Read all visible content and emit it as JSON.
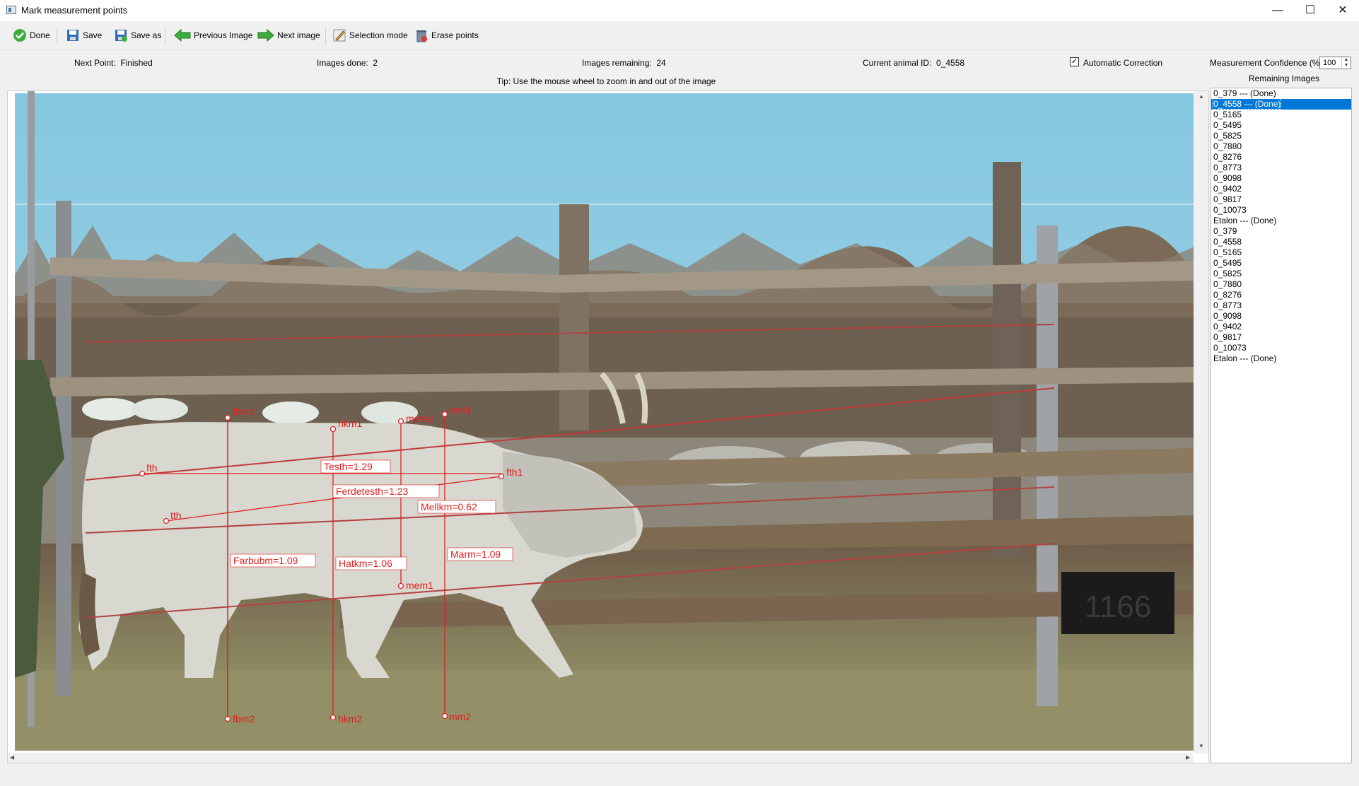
{
  "window": {
    "title": "Mark measurement points"
  },
  "toolbar": {
    "done": "Done",
    "save": "Save",
    "save_as": "Save as",
    "previous_image": "Previous Image",
    "next_image": "Next image",
    "selection_mode": "Selection mode",
    "erase_points": "Erase points"
  },
  "status": {
    "next_point": "Next Point:  Finished",
    "images_done": "Images done:  2",
    "images_remaining": "Images remaining:  24",
    "current_animal": "Current animal ID:  0_4558",
    "auto_correction_label": "Automatic Correction",
    "auto_correction_checked": true,
    "confidence_label": "Measurement Confidence (%):",
    "confidence_value": "100"
  },
  "tip": "Tip: Use the mouse wheel to zoom in and out of the image",
  "remaining": {
    "title": "Remaining Images",
    "items": [
      "0_379 --- (Done)",
      "0_4558 --- (Done)",
      "0_5165",
      "0_5495",
      "0_5825",
      "0_7880",
      "0_8276",
      "0_8773",
      "0_9098",
      "0_9402",
      "0_9817",
      "0_10073",
      "Etalon --- (Done)",
      "0_379",
      "0_4558",
      "0_5165",
      "0_5495",
      "0_5825",
      "0_7880",
      "0_8276",
      "0_8773",
      "0_9098",
      "0_9402",
      "0_9817",
      "0_10073",
      "Etalon --- (Done)"
    ],
    "selected_index": 1
  },
  "image": {
    "background_sign": "1166",
    "annotation_color": "#e02020",
    "points": {
      "fbm1": "fbm1",
      "fbm2": "fbm2",
      "hkm1": "hkm1",
      "hkm2": "hkm2",
      "mem2": "mem2",
      "mem1": "mem1",
      "mm1": "mm1",
      "mm2": "mm2",
      "fth1": "fth1",
      "fth_left": "fth",
      "tth": "tth"
    },
    "labels": {
      "testh": "Testh=1.29",
      "ferdetesth": "Ferdetesth=1.23",
      "mellkm": "Mellkm=0.62",
      "farbubm": "Farbubm=1.09",
      "hatkm": "Hatkm=1.06",
      "marm": "Marm=1.09"
    }
  }
}
